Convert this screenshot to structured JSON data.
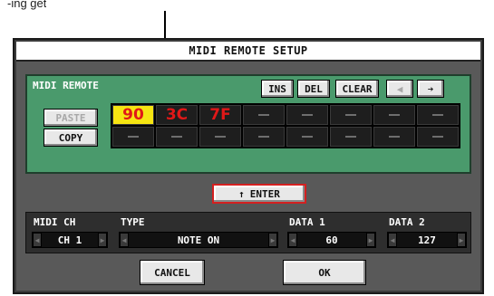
{
  "annotation": {
    "text": "-ing get"
  },
  "dialog": {
    "title": "MIDI REMOTE SETUP",
    "remote": {
      "title": "MIDI REMOTE",
      "buttons": {
        "ins": "INS",
        "del": "DEL",
        "clear": "CLEAR",
        "left_arrow": "◀",
        "right_arrow": "➔"
      },
      "paste": "PASTE",
      "copy": "COPY",
      "cells_row1": [
        "90",
        "3C",
        "7F",
        "",
        "",
        "",
        "",
        ""
      ],
      "cells_row2": [
        "",
        "",
        "",
        "",
        "",
        "",
        "",
        ""
      ]
    },
    "enter": {
      "arrow": "↑",
      "label": "ENTER"
    },
    "params": {
      "midi_ch": {
        "label": "MIDI CH",
        "value": "CH 1"
      },
      "type": {
        "label": "TYPE",
        "value": "NOTE ON"
      },
      "data1": {
        "label": "DATA 1",
        "value": "60"
      },
      "data2": {
        "label": "DATA 2",
        "value": "127"
      }
    },
    "cancel": "CANCEL",
    "ok": "OK"
  }
}
